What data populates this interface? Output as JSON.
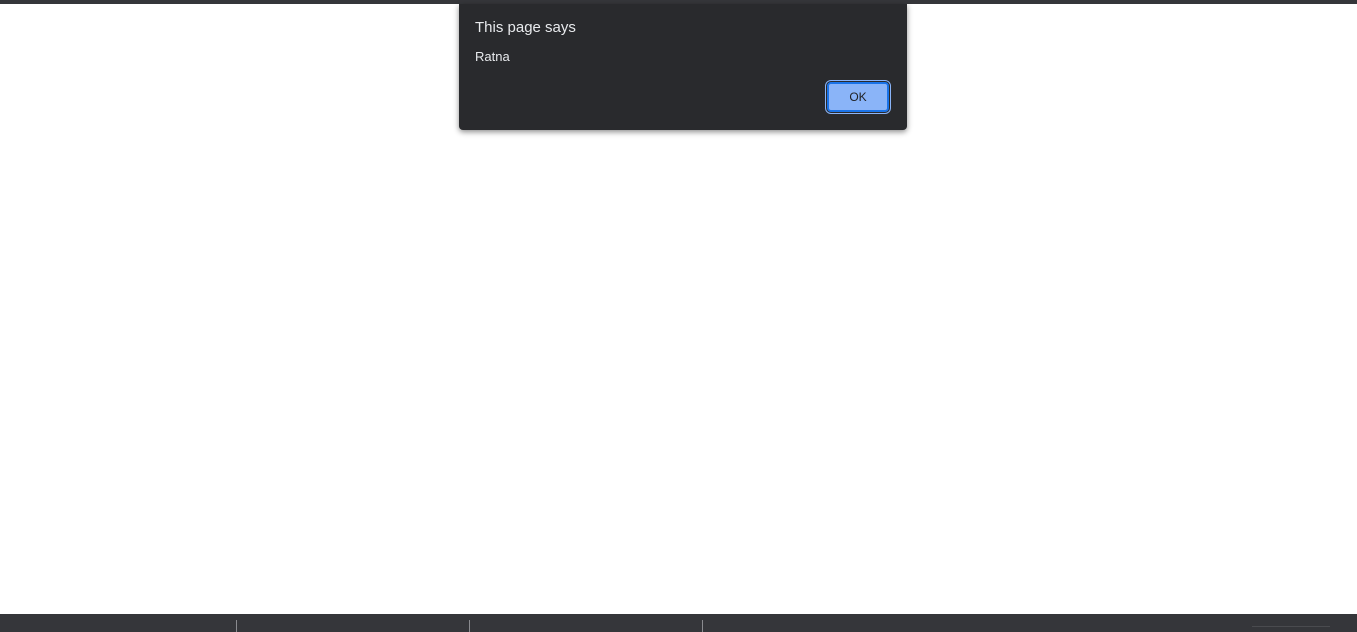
{
  "dialog": {
    "title": "This page says",
    "message": "Ratna",
    "ok_label": "OK"
  },
  "colors": {
    "dialog_background": "#292a2d",
    "dialog_text": "#e8eaed",
    "button_background": "#8ab4f8",
    "button_border": "#1a73e8",
    "chrome_dark": "#35363a",
    "page_background": "#ffffff"
  }
}
